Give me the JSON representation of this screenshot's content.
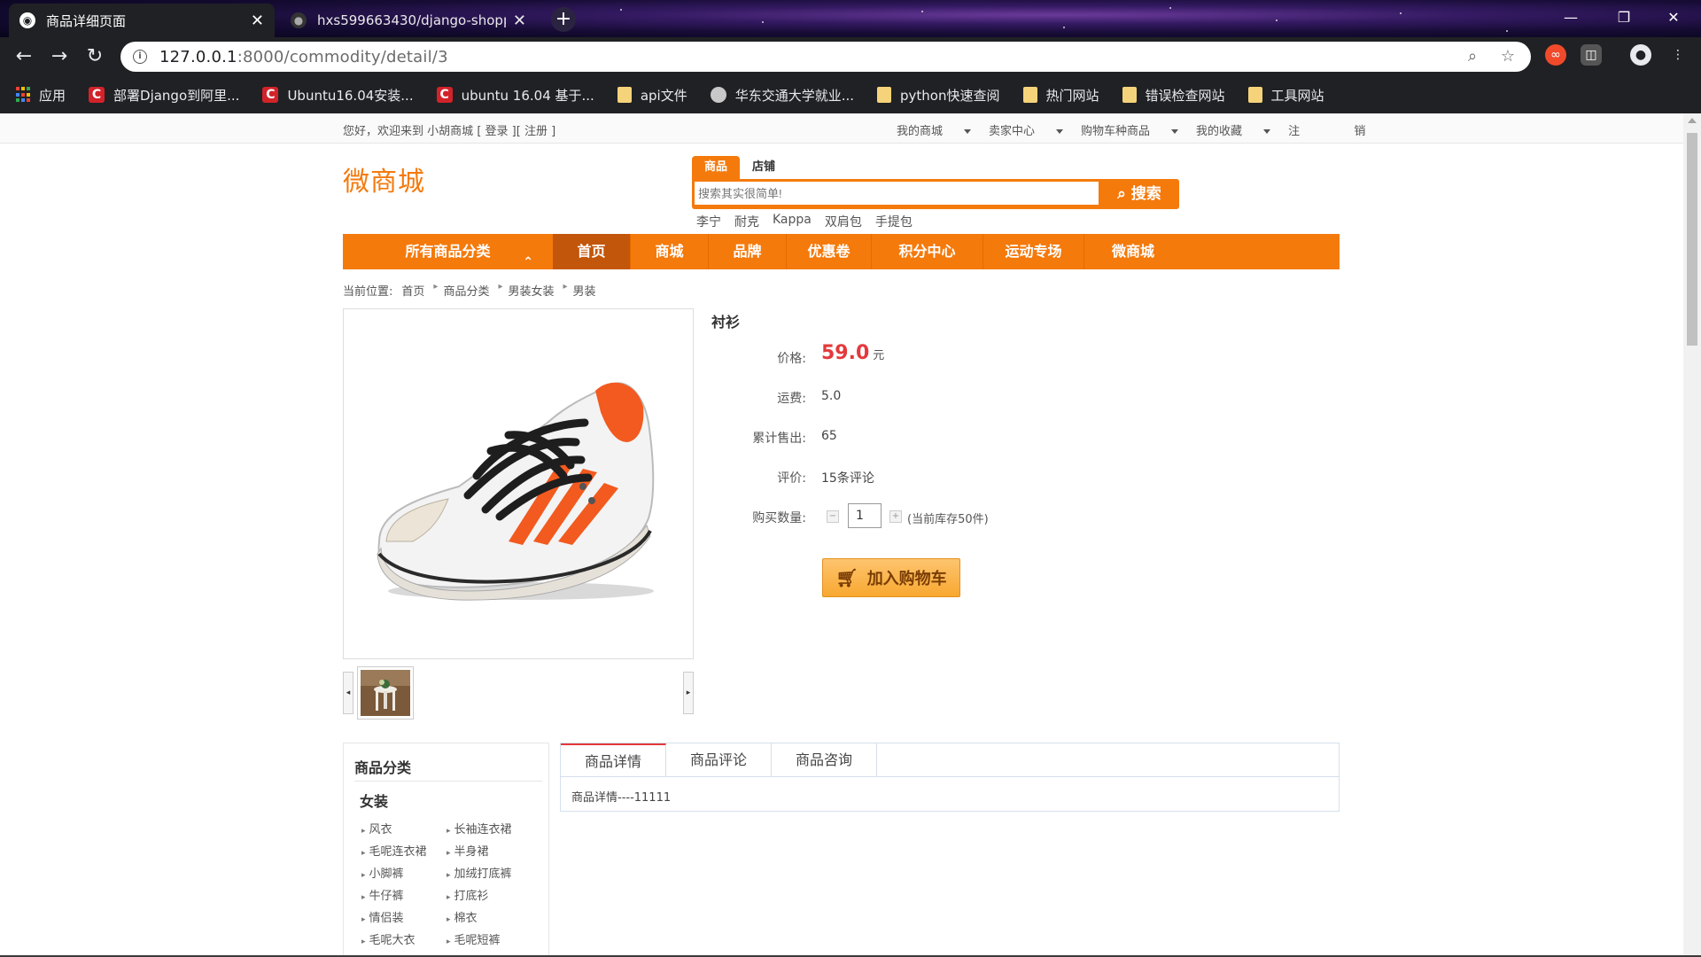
{
  "browser": {
    "tabs": [
      {
        "title": "商品详细页面",
        "active": true,
        "icon": "globe-icon"
      },
      {
        "title": "hxs599663430/django-shoppi",
        "active": false,
        "icon": "github-icon"
      }
    ],
    "new_tab_label": "+",
    "address": {
      "host": "127.0.0.1",
      "path": ":8000/commodity/detail/3"
    },
    "bookmarks": [
      {
        "label": "应用",
        "icon": "apps-icon"
      },
      {
        "label": "部署Django到阿里...",
        "icon": "csdn-icon"
      },
      {
        "label": "Ubuntu16.04安装...",
        "icon": "csdn-icon"
      },
      {
        "label": "ubuntu 16.04 基于...",
        "icon": "csdn-icon"
      },
      {
        "label": "api文件",
        "icon": "folder-icon"
      },
      {
        "label": "华东交通大学就业...",
        "icon": "globe-icon"
      },
      {
        "label": "python快速查阅",
        "icon": "folder-icon"
      },
      {
        "label": "热门网站",
        "icon": "folder-icon"
      },
      {
        "label": "错误检查网站",
        "icon": "folder-icon"
      },
      {
        "label": "工具网站",
        "icon": "folder-icon"
      }
    ]
  },
  "topbar": {
    "greeting": "您好，欢迎来到",
    "user": "小胡商城",
    "login": "[ 登录 ]",
    "register": "[ 注册 ]",
    "links": [
      "我的商城",
      "卖家中心",
      "购物车种商品",
      "我的收藏"
    ],
    "logout_1": "注",
    "logout_2": "销"
  },
  "logo": "微商城",
  "search": {
    "tab_goods": "商品",
    "tab_shop": "店铺",
    "placeholder": "搜索其实很简单!",
    "button": "搜索",
    "hot_words": [
      "李宁",
      "耐克",
      "Kappa",
      "双肩包",
      "手提包"
    ]
  },
  "nav": {
    "all_categories": "所有商品分类",
    "items": [
      "首页",
      "商城",
      "品牌",
      "优惠卷",
      "积分中心",
      "运动专场",
      "微商城"
    ]
  },
  "breadcrumb": {
    "label": "当前位置:",
    "items": [
      "首页",
      "商品分类",
      "男装女装",
      "男装"
    ]
  },
  "product": {
    "title": "衬衫",
    "price_label": "价格:",
    "price": "59.0",
    "price_unit": "元",
    "shipping_label": "运费:",
    "shipping": "5.0",
    "sold_label": "累计售出:",
    "sold": "65",
    "rating_label": "评价:",
    "rating": "15条评论",
    "qty_label": "购买数量:",
    "qty": "1",
    "stock_note": "(当前库存50件)",
    "add_to_cart": "加入购物车"
  },
  "sidebar": {
    "title": "商品分类",
    "group": "女装",
    "items": [
      "风衣",
      "长袖连衣裙",
      "毛呢连衣裙",
      "半身裙",
      "小脚裤",
      "加绒打底裤",
      "牛仔裤",
      "打底衫",
      "情侣装",
      "棉衣",
      "毛呢大衣",
      "毛呢短裤"
    ]
  },
  "detail_tabs": {
    "tabs": [
      "商品详情",
      "商品评论",
      "商品咨询"
    ],
    "content": "商品详情----11111"
  },
  "colors": {
    "accent": "#f47a0c",
    "price": "#e4393c",
    "nav_active": "#c2560b"
  }
}
